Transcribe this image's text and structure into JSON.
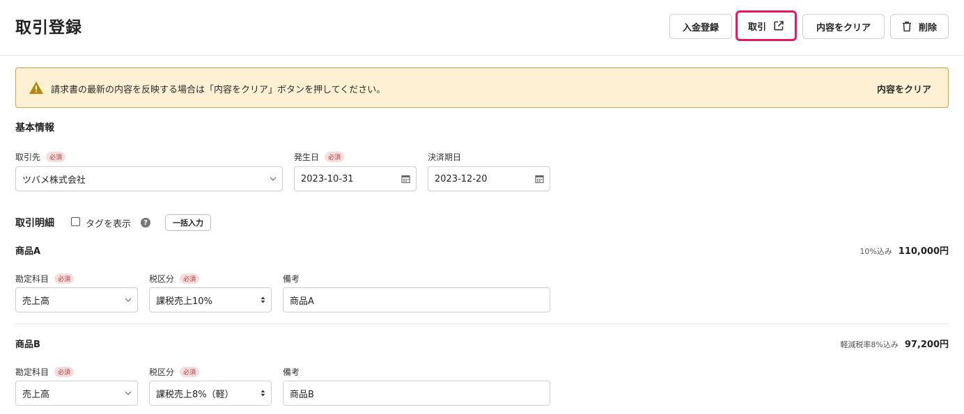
{
  "header": {
    "title": "取引登録",
    "buttons": {
      "payment": "入金登録",
      "transaction": "取引",
      "clear": "内容をクリア",
      "delete": "削除"
    }
  },
  "alert": {
    "message": "請求書の最新の内容を反映する場合は「内容をクリア」ボタンを押してください。",
    "action": "内容をクリア"
  },
  "basic_info": {
    "title": "基本情報",
    "required_badge": "必須",
    "partner": {
      "label": "取引先",
      "value": "ツバメ株式会社"
    },
    "issue_date": {
      "label": "発生日",
      "value": "2023-10-31"
    },
    "due_date": {
      "label": "決済期日",
      "value": "2023-12-20"
    }
  },
  "details": {
    "title": "取引明細",
    "show_tags": "タグを表示",
    "bulk_input": "一括入力",
    "items": [
      {
        "name": "商品A",
        "tax_note": "10%込み",
        "amount": "110,000円",
        "account_label": "勘定科目",
        "account_value": "売上高",
        "tax_label": "税区分",
        "tax_value": "課税売上10%",
        "memo_label": "備考",
        "memo_value": "商品A"
      },
      {
        "name": "商品B",
        "tax_note": "軽減税率8%込み",
        "amount": "97,200円",
        "account_label": "勘定科目",
        "account_value": "売上高",
        "tax_label": "税区分",
        "tax_value": "課税売上8%（軽）",
        "memo_label": "備考",
        "memo_value": "商品B"
      }
    ]
  },
  "colors": {
    "highlight": "#e8185b",
    "alert_bg": "#fdf0d3",
    "alert_border": "#c9a441",
    "warning_icon": "#b8860b"
  },
  "icons": [
    "external-link-icon",
    "trash-icon",
    "warning-icon",
    "chevron-down-icon",
    "calendar-icon",
    "select-arrows-icon",
    "help-icon"
  ]
}
